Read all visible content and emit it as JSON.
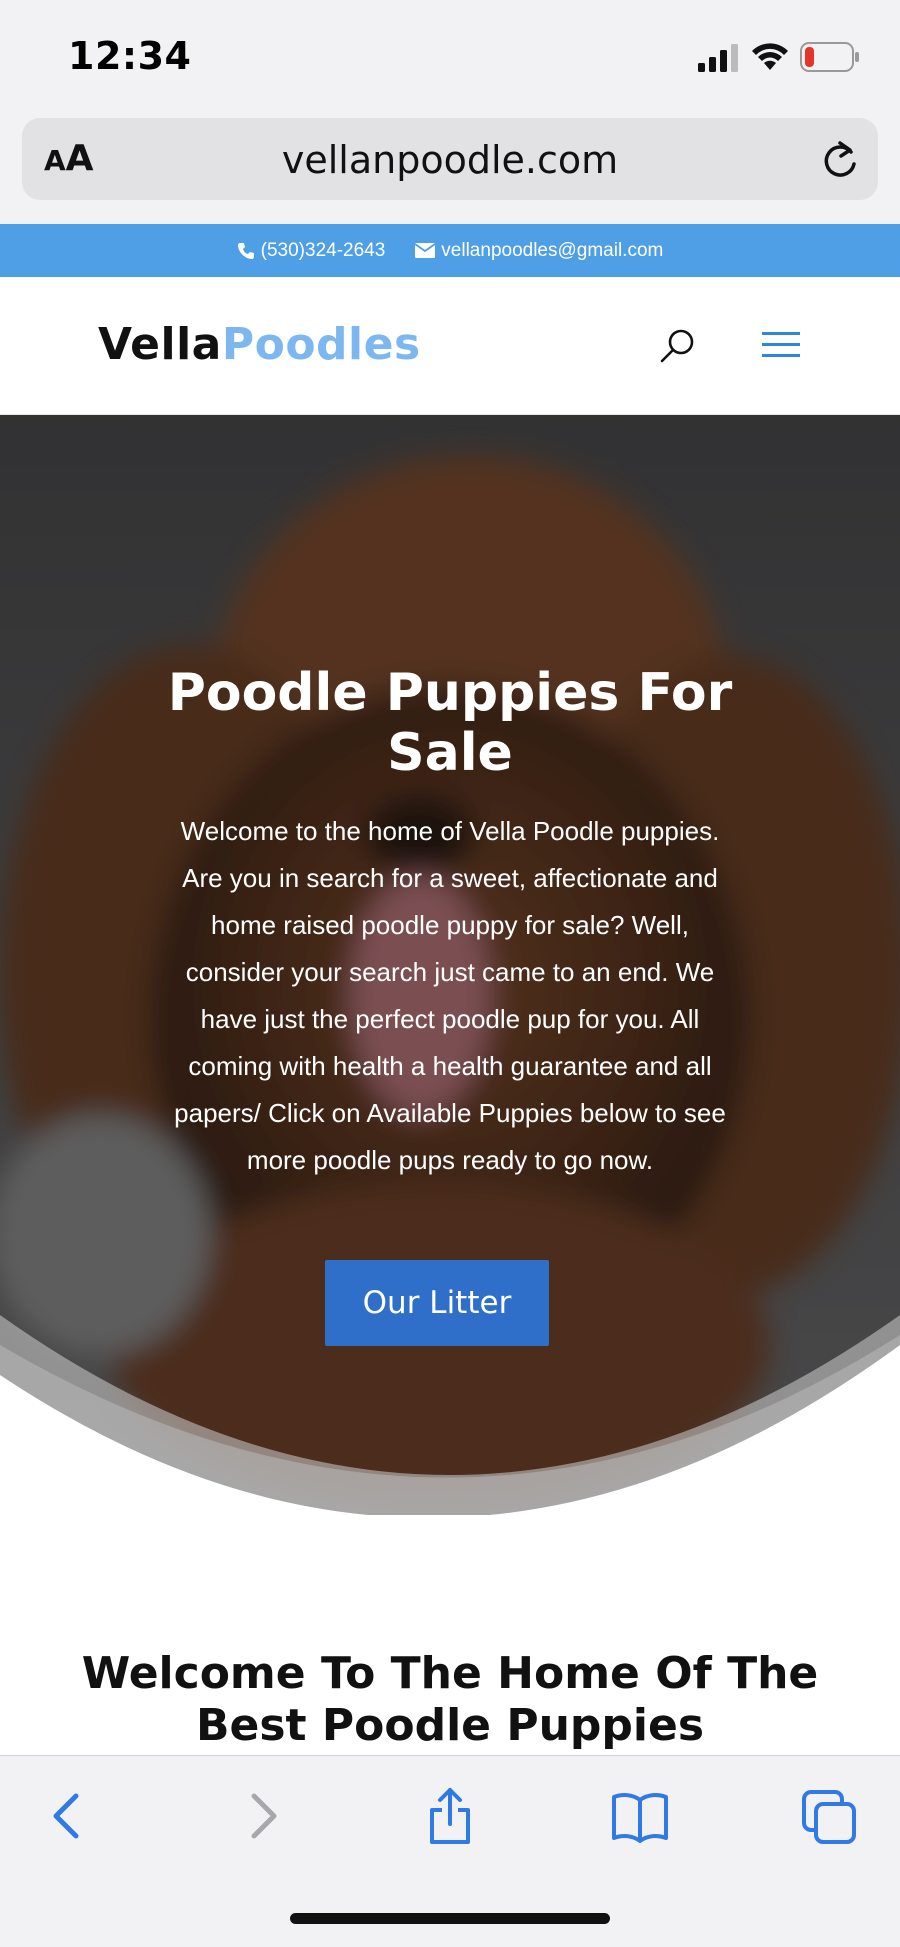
{
  "status_bar": {
    "time": "12:34"
  },
  "browser": {
    "text_size_small": "A",
    "text_size_big": "A",
    "url": "vellanpoodle.com"
  },
  "contact": {
    "phone": "(530)324-2643",
    "email": "vellanpoodles@gmail.com"
  },
  "header": {
    "logo_part1": "Vella",
    "logo_part2": "Poodles"
  },
  "hero": {
    "title": "Poodle Puppies For Sale",
    "text": "Welcome to the home of Vella Poodle puppies. Are you in search for a sweet, affectionate and home raised poodle puppy for sale? Well, consider your search just came to an end. We have just the perfect poodle pup for you. All coming with health a health guarantee and all papers/ Click on Available Puppies below to see more poodle pups ready to go now.",
    "button_label": "Our Litter"
  },
  "welcome": {
    "title": "Welcome To The Home Of The Best Poodle Puppies"
  },
  "colors": {
    "contact_strip": "#4f9fe6",
    "logo_accent": "#7db7f0",
    "button": "#2f6fc9",
    "toolbar_icons": "#2f7ae5"
  },
  "icons": {
    "back": "chevron-left-icon",
    "forward": "chevron-right-icon",
    "share": "share-icon",
    "bookmarks": "book-icon",
    "tabs": "tabs-icon"
  }
}
